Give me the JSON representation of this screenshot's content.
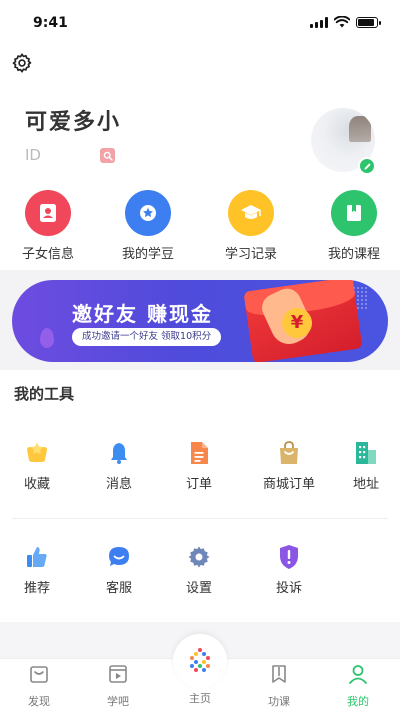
{
  "status": {
    "time": "9:41",
    "battery_level": 0.9
  },
  "profile": {
    "name": "可爱多小",
    "id_label": "ID"
  },
  "quick_entries": [
    {
      "label": "子女信息",
      "icon": "child-card-icon",
      "color": "#f0485a"
    },
    {
      "label": "我的学豆",
      "icon": "star-bean-icon",
      "color": "#3d7ff0"
    },
    {
      "label": "学习记录",
      "icon": "graduation-cap-icon",
      "color": "#ffc227"
    },
    {
      "label": "我的课程",
      "icon": "book-icon",
      "color": "#2ec46d"
    }
  ],
  "banner": {
    "title": "邀好友 赚现金",
    "subtitle": "成功邀请一个好友 领取10积分",
    "coin_symbol": "¥"
  },
  "tools": {
    "title": "我的工具",
    "items": [
      {
        "label": "收藏",
        "icon": "star-icon"
      },
      {
        "label": "消息",
        "icon": "bell-icon"
      },
      {
        "label": "订单",
        "icon": "document-icon"
      },
      {
        "label": "商城订单",
        "icon": "shopping-bag-icon"
      },
      {
        "label": "地址",
        "icon": "building-icon"
      },
      {
        "label": "推荐",
        "icon": "thumbs-up-icon"
      },
      {
        "label": "客服",
        "icon": "chat-bubble-icon"
      },
      {
        "label": "设置",
        "icon": "gear-icon"
      },
      {
        "label": "投诉",
        "icon": "shield-alert-icon"
      }
    ]
  },
  "tabbar": {
    "tabs": [
      {
        "label": "发现",
        "icon": "discover-icon"
      },
      {
        "label": "学吧",
        "icon": "play-icon"
      },
      {
        "label": "主页",
        "icon": "home-logo-icon"
      },
      {
        "label": "功课",
        "icon": "homework-icon"
      },
      {
        "label": "我的",
        "icon": "profile-icon"
      }
    ],
    "active": "我的",
    "accent_color": "#2ec46d"
  }
}
